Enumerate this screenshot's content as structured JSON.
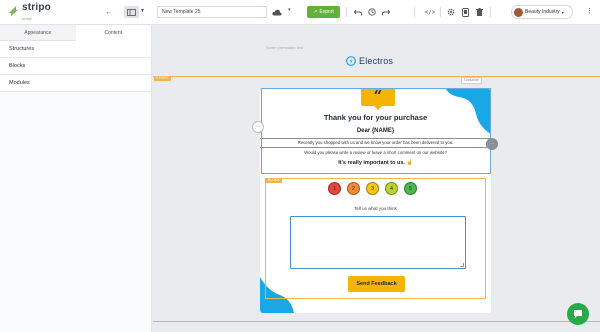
{
  "app": {
    "logo_name": "stripo",
    "logo_sub": "email"
  },
  "topbar": {
    "template_name": "New Template 25",
    "export_label": "Export",
    "account_name": "Beauty Industry"
  },
  "left_panel": {
    "tabs": [
      {
        "label": "Appearance",
        "active": false
      },
      {
        "label": "Content",
        "active": true
      }
    ],
    "items": [
      {
        "label": "Structures"
      },
      {
        "label": "Blocks"
      },
      {
        "label": "Modules"
      }
    ]
  },
  "canvas": {
    "preheader": "Some preheader text",
    "brand_name": "Electros",
    "stripe_badge_top": "STRIPE",
    "stripe_badge_block": "BLOCK",
    "container_label": "Container"
  },
  "email": {
    "quote_mark": "“",
    "title": "Thank you for your purchase",
    "dear": "Dear {NAME}",
    "line1": "Recently you shopped with us and we know your order has been delivered to you.",
    "line2": "Would you please write a review or leave a short comment on our website?",
    "important": "It's really important to us.",
    "ratings": [
      {
        "label": "1",
        "color": "#e8463b"
      },
      {
        "label": "2",
        "color": "#f08a34"
      },
      {
        "label": "3",
        "color": "#f5c518"
      },
      {
        "label": "4",
        "color": "#b8d432"
      },
      {
        "label": "5",
        "color": "#4cb84c"
      }
    ],
    "tell_label": "Tell us what you think",
    "send_label": "Send Feedback"
  },
  "colors": {
    "accent_green": "#62b13a",
    "button_yellow": "#f5b400",
    "wave_blue": "#1aa7e6",
    "guide_orange": "#f0b24a"
  }
}
